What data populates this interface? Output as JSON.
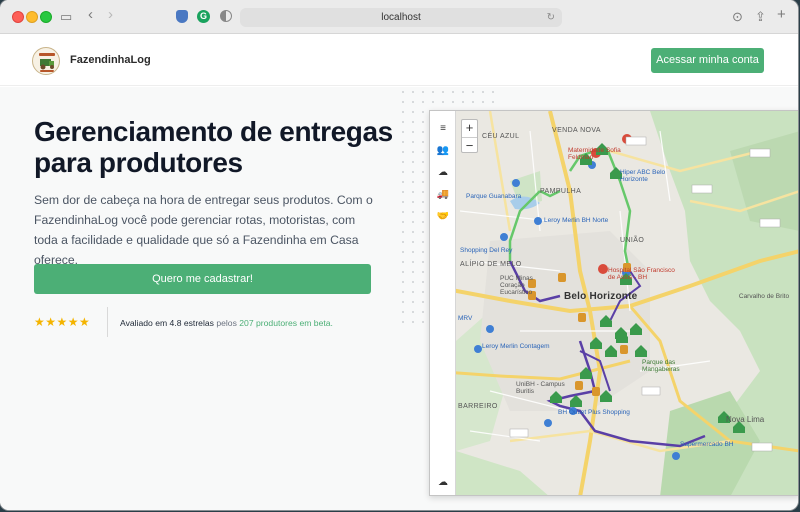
{
  "browser": {
    "address": "localhost"
  },
  "header": {
    "brand": "FazendinhaLog",
    "login_button": "Acessar minha conta"
  },
  "hero": {
    "title": "Gerenciamento de entregas para produtores",
    "lead": "Sem dor de cabeça na hora de entregar seus produtos. Com o FazendinhaLog você pode gerenciar rotas, motoristas, com toda a facilidade e qualidade que só a Fazendinha em Casa oferece.",
    "signup_button": "Quero me cadastrar!",
    "stars": "★★★★★",
    "rating_prefix": "Avaliado em 4.8 estrelas",
    "rating_mid": " pelos ",
    "rating_link": "207 produtores em beta."
  },
  "map": {
    "zoom_in": "+",
    "zoom_out": "−",
    "labels": {
      "ceu_azul": "CÉU AZUL",
      "venda_nova": "VENDA NOVA",
      "pampulha": "PAMPULHA",
      "uniao": "UNIÃO",
      "alipio": "ALÍPIO DE MELO",
      "bh": "Belo Horizonte",
      "barreiro": "BARREIRO",
      "nova_lima": "Nova Lima",
      "carvalho": "Carvalho de Brito",
      "hiper": "Hiper ABC Belo Horizonte",
      "leroy_norte": "Leroy Merlin BH Norte",
      "leroy_cont": "Leroy Merlin Contagem",
      "parque_guan": "Parque Guanabara",
      "shopping": "Shopping Del Rey",
      "puc": "PUC Minas Coração Eucarístico",
      "hospital_sf": "Hospital São Francisco de Assis - BH",
      "hosp_mat": "Maternidade Sofia Feldman",
      "unibh": "UniBH - Campus Buritis",
      "outlet": "BH Outlet Plus Shopping",
      "mangabeiras": "Parque das Mangabeiras",
      "mrv": "MRV",
      "supermercado": "Supermercado BH"
    }
  },
  "colors": {
    "accent": "#4caf76",
    "route_purple": "#5a3fa6",
    "route_green": "#66c86a",
    "marker_green": "#3a9a4c"
  }
}
